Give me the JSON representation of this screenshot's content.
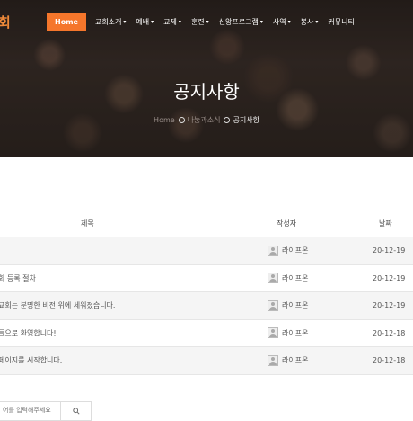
{
  "header": {
    "logo_text": "회",
    "nav": [
      {
        "label": "Home",
        "has_menu": false
      },
      {
        "label": "교회소개",
        "has_menu": true
      },
      {
        "label": "예배",
        "has_menu": true
      },
      {
        "label": "교제",
        "has_menu": true
      },
      {
        "label": "훈련",
        "has_menu": true
      },
      {
        "label": "신앙프로그램",
        "has_menu": true
      },
      {
        "label": "사역",
        "has_menu": true
      },
      {
        "label": "봉사",
        "has_menu": true
      },
      {
        "label": "커뮤니티",
        "has_menu": false
      }
    ]
  },
  "hero": {
    "title": "공지사항",
    "breadcrumb": {
      "home": "Home",
      "section": "나눔과소식",
      "current": "공지사항"
    }
  },
  "table": {
    "headers": {
      "title": "제목",
      "author": "작성자",
      "date": "날짜"
    },
    "rows": [
      {
        "title": "",
        "author": "라이프온",
        "date": "20-12-19"
      },
      {
        "title": "회 등록 절차",
        "author": "라이프온",
        "date": "20-12-19"
      },
      {
        "title": "교회는 분명한 비전 위에 세워졌습니다.",
        "author": "라이프온",
        "date": "20-12-19"
      },
      {
        "title": "들으로 환영합니다!",
        "author": "라이프온",
        "date": "20-12-18"
      },
      {
        "title": "페이지를 시작합니다.",
        "author": "라이프온",
        "date": "20-12-18"
      }
    ]
  },
  "search": {
    "placeholder": "어를 입력해주세요"
  },
  "colors": {
    "accent": "#f5762b",
    "logo": "#f08a3a"
  }
}
